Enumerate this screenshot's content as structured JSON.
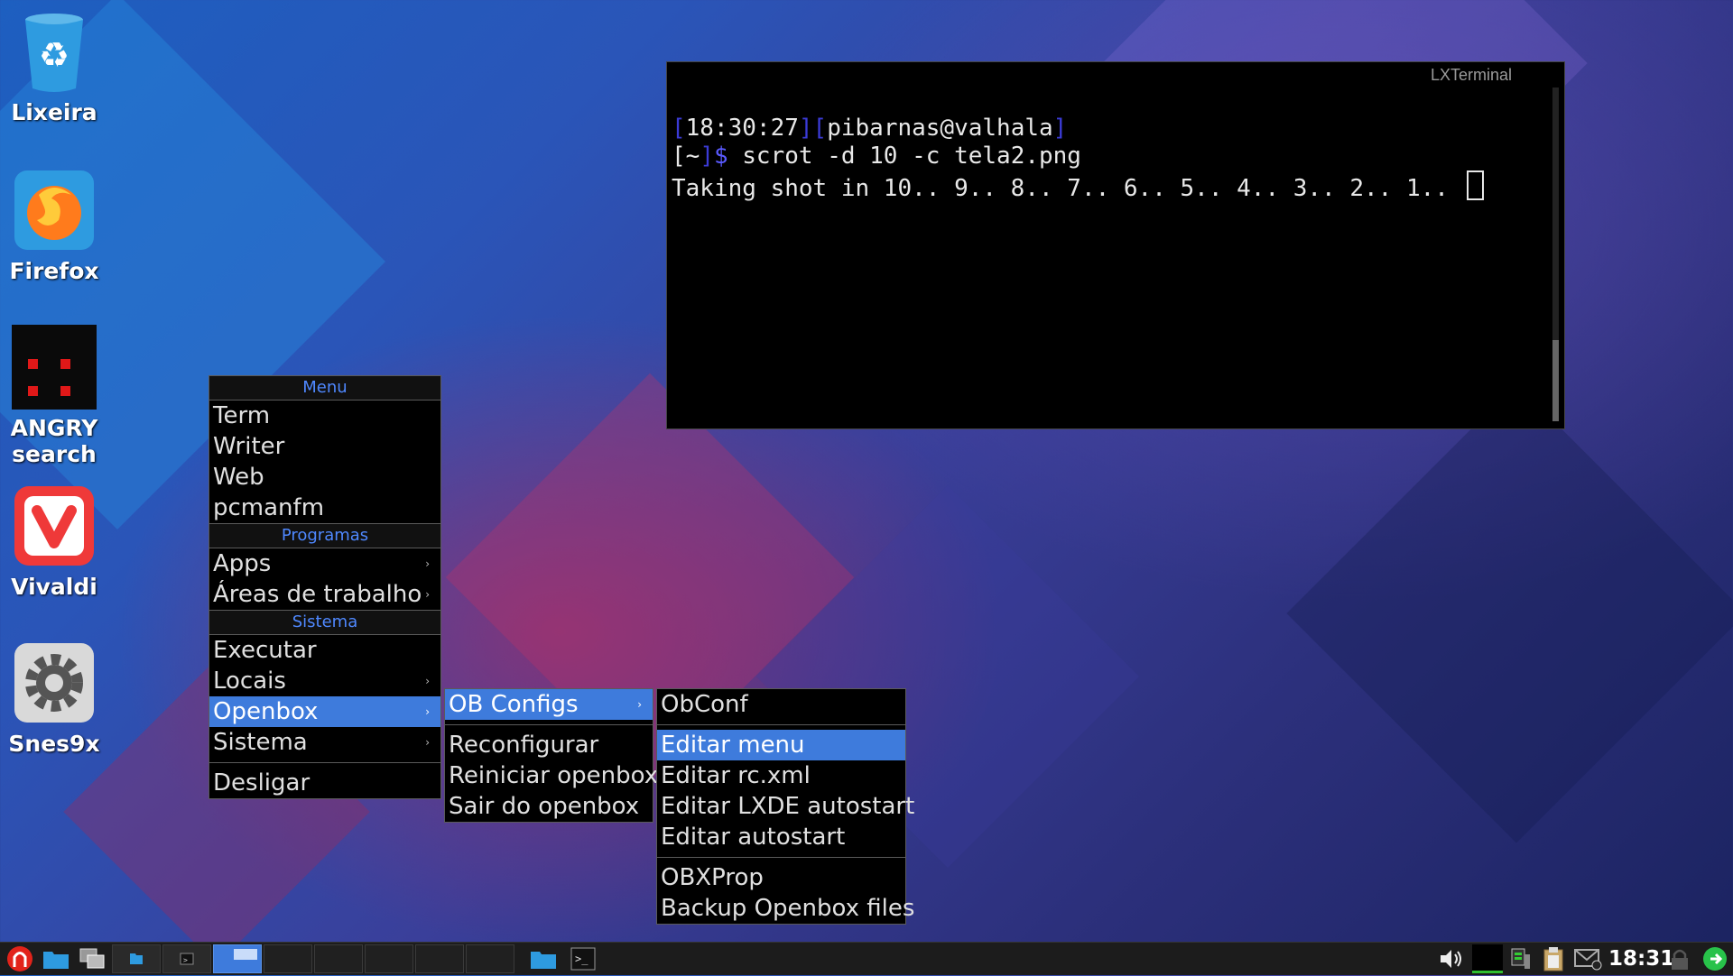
{
  "desktop": {
    "icons": [
      {
        "label": "Lixeira"
      },
      {
        "label": "Firefox"
      },
      {
        "label": "ANGRY\nsearch",
        "line1": "ANGRY",
        "line2": "search"
      },
      {
        "label": "Vivaldi"
      },
      {
        "label": "Snes9x"
      }
    ]
  },
  "terminal": {
    "title": "LXTerminal",
    "prompt_time": "18:30:27",
    "prompt_user": "pibarnas@valhala",
    "prompt_dir": "~",
    "prompt_symbol": "$",
    "command": " scrot -d 10 -c tela2.png",
    "output": "Taking shot in 10.. 9.. 8.. 7.. 6.. 5.. 4.. 3.. 2.. 1.. "
  },
  "menu_root": {
    "header_menu": "Menu",
    "items_top": [
      "Term",
      "Writer",
      "Web",
      "pcmanfm"
    ],
    "header_programs": "Programas",
    "items_programs": [
      "Apps",
      "Áreas de trabalho"
    ],
    "header_system": "Sistema",
    "items_system": [
      "Executar",
      "Locais",
      "Openbox",
      "Sistema"
    ],
    "shutdown": "Desligar"
  },
  "menu_openbox": {
    "items": [
      "OB Configs",
      "Reconfigurar",
      "Reiniciar openbox",
      "Sair do openbox"
    ]
  },
  "menu_obconfigs": {
    "items": [
      "ObConf",
      "Editar menu",
      "Editar rc.xml",
      "Editar LXDE autostart",
      "Editar autostart",
      "OBXProp",
      "Backup Openbox files"
    ]
  },
  "taskbar": {
    "clock": "18:31",
    "accent": "#3e7bdc"
  }
}
